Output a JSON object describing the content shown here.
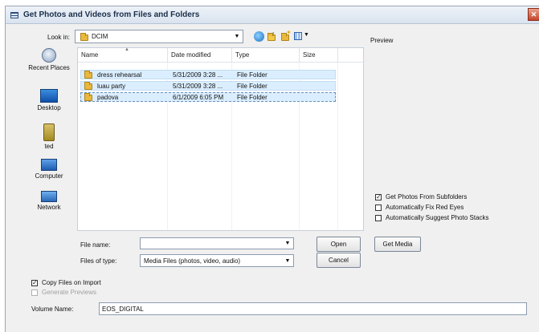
{
  "window": {
    "title": "Get Photos and Videos from Files and Folders",
    "close_glyph": "✕"
  },
  "lookin": {
    "label": "Look in:",
    "value": "DCIM"
  },
  "toolbar": {
    "back_icon": "back-icon",
    "up_icon": "up-folder-icon",
    "new_folder_icon": "new-folder-icon",
    "views_icon": "views-menu-icon"
  },
  "preview": {
    "label": "Preview"
  },
  "places": [
    {
      "label": "Recent Places",
      "icon": "recent-places-icon"
    },
    {
      "label": "Desktop",
      "icon": "desktop-icon"
    },
    {
      "label": "ted",
      "icon": "user-folder-icon"
    },
    {
      "label": "Computer",
      "icon": "computer-icon"
    },
    {
      "label": "Network",
      "icon": "network-icon"
    }
  ],
  "filelist": {
    "columns": [
      "Name",
      "Date modified",
      "Type",
      "Size"
    ],
    "rows": [
      {
        "name": "dress rehearsal",
        "date": "5/31/2009 3:28 ...",
        "type": "File Folder",
        "size": ""
      },
      {
        "name": "luau party",
        "date": "5/31/2009 3:28 ...",
        "type": "File Folder",
        "size": ""
      },
      {
        "name": "padova",
        "date": "6/1/2009 6:05 PM",
        "type": "File Folder",
        "size": ""
      }
    ]
  },
  "options": {
    "subfolders": {
      "label": "Get Photos From Subfolders",
      "checked": true
    },
    "red_eyes": {
      "label": "Automatically Fix Red Eyes",
      "checked": false
    },
    "stacks": {
      "label": "Automatically Suggest Photo Stacks",
      "checked": false
    }
  },
  "filename": {
    "label": "File name:",
    "value": ""
  },
  "filetype": {
    "label": "Files of type:",
    "value": "Media Files (photos, video, audio)"
  },
  "buttons": {
    "open": "Open",
    "cancel": "Cancel",
    "get_media": "Get Media"
  },
  "copy_files": {
    "label": "Copy Files on Import",
    "checked": true
  },
  "generate_previews": {
    "label": "Generate Previews",
    "checked": false,
    "disabled": true
  },
  "volume": {
    "label": "Volume Name:",
    "value": "EOS_DIGITAL"
  },
  "check_glyph": "✓",
  "dropdown_glyph": "▼"
}
